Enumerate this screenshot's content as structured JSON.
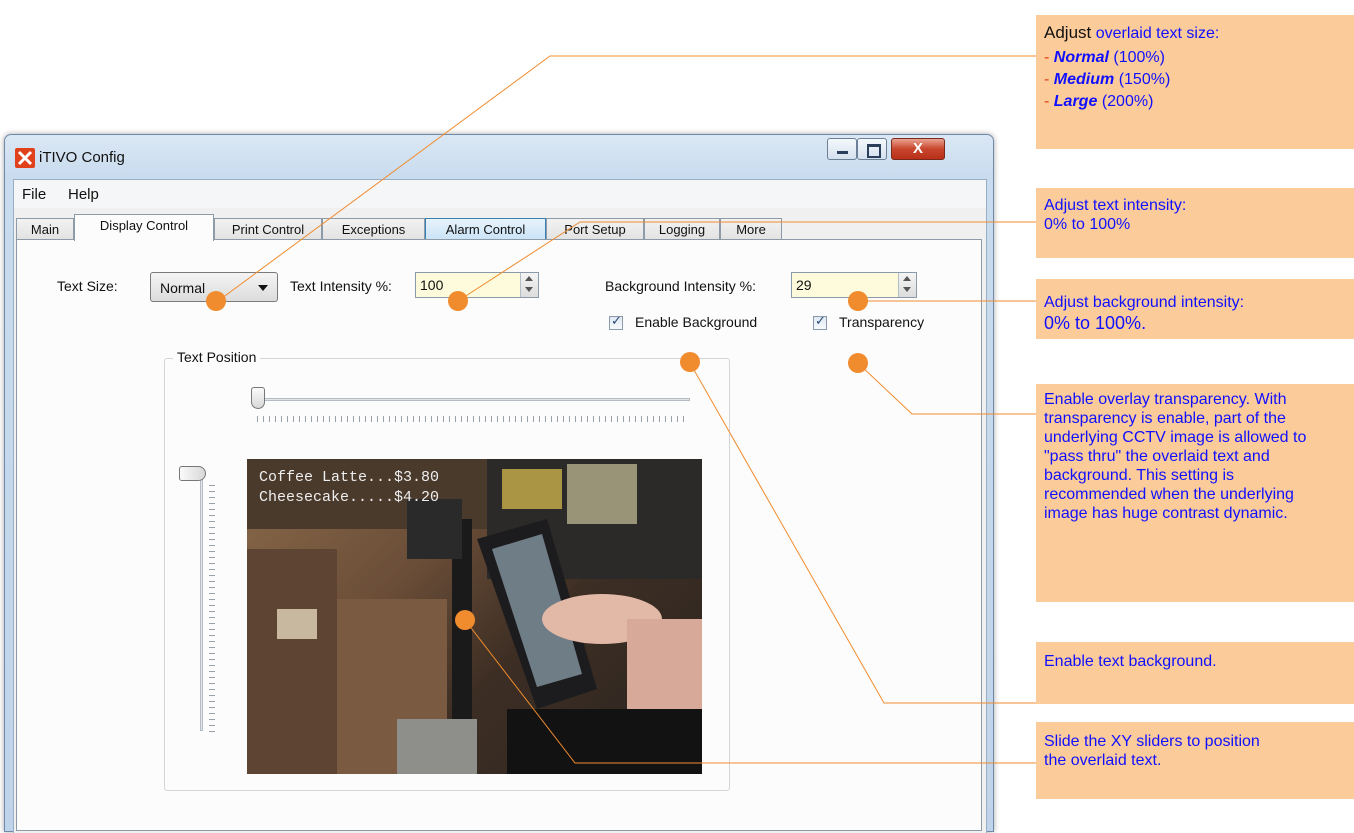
{
  "window": {
    "title": "iTIVO Config"
  },
  "menu": {
    "items": [
      "File",
      "Help"
    ]
  },
  "tabs": [
    "Main",
    "Display Control",
    "Print Control",
    "Exceptions",
    "Alarm Control",
    "Port Setup",
    "Logging",
    "More"
  ],
  "active_tab": "Display Control",
  "display": {
    "text_size_label": "Text Size:",
    "text_size_value": "Normal",
    "text_intensity_label": "Text Intensity %:",
    "text_intensity_value": "100",
    "background_intensity_label": "Background Intensity %:",
    "background_intensity_value": "29",
    "enable_background_label": "Enable Background",
    "enable_background_checked": true,
    "transparency_label": "Transparency",
    "transparency_checked": true,
    "text_position_title": "Text Position",
    "preview_lines": [
      "Coffee Latte...$3.80",
      "Cheesecake.....$4.20"
    ]
  },
  "callouts": {
    "size": {
      "lead_black": "Adjust",
      "lead_blue": "overlaid text size:",
      "items": [
        {
          "name": "Normal",
          "pct": "(100%)"
        },
        {
          "name": "Medium",
          "pct": "(150%)"
        },
        {
          "name": "Large",
          "pct": "(200%)"
        }
      ]
    },
    "intensity": [
      "Adjust text intensity:",
      "0% to 100%"
    ],
    "background_intensity": [
      "Adjust background intensity:",
      "0% to 100%."
    ],
    "transparency": "Enable overlay transparency. With transparency is enable, part of the underlying CCTV image is allowed to \"pass thru\" the overlaid text and background. This setting is recommended when the underlying image has huge contrast dynamic.",
    "background": "Enable text background.",
    "position": "Slide the XY sliders to position the overlaid text."
  },
  "colors": {
    "callout_bg": "#fbcb9a",
    "callout_text": "#1010ff",
    "marker": "#f08c2e"
  }
}
